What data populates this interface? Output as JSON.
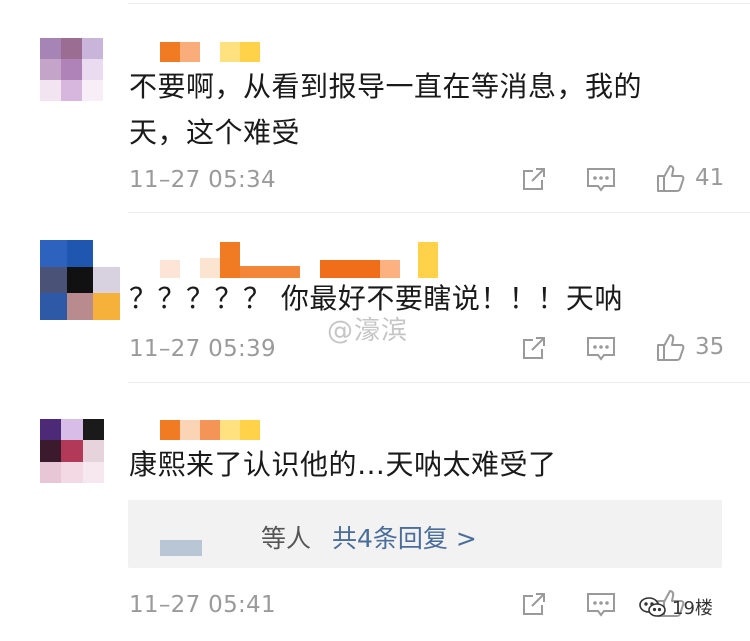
{
  "comments": [
    {
      "text": "不要啊，从看到报导一直在等消息，我的天，这个难受",
      "time": "11–27 05:34",
      "likes": "41"
    },
    {
      "text": "？？？？？ 你最好不要瞎说！！！天呐",
      "time": "11–27 05:39",
      "likes": "35"
    },
    {
      "text": "康熙来了认识他的…天呐太难受了",
      "time": "11–27 05:41",
      "likes": "",
      "reply_prefix": "等人",
      "reply_link": "共4条回复 >"
    }
  ],
  "watermark": "@濠滨",
  "corner_logo": "19楼",
  "colors": {
    "text": "#1a1a1a",
    "muted": "#9a9a9a",
    "link": "#4a6d9a",
    "reply_bg": "#f2f2f2"
  },
  "icons": [
    "share-icon",
    "comment-icon",
    "thumbs-up-icon",
    "wechat-icon"
  ]
}
